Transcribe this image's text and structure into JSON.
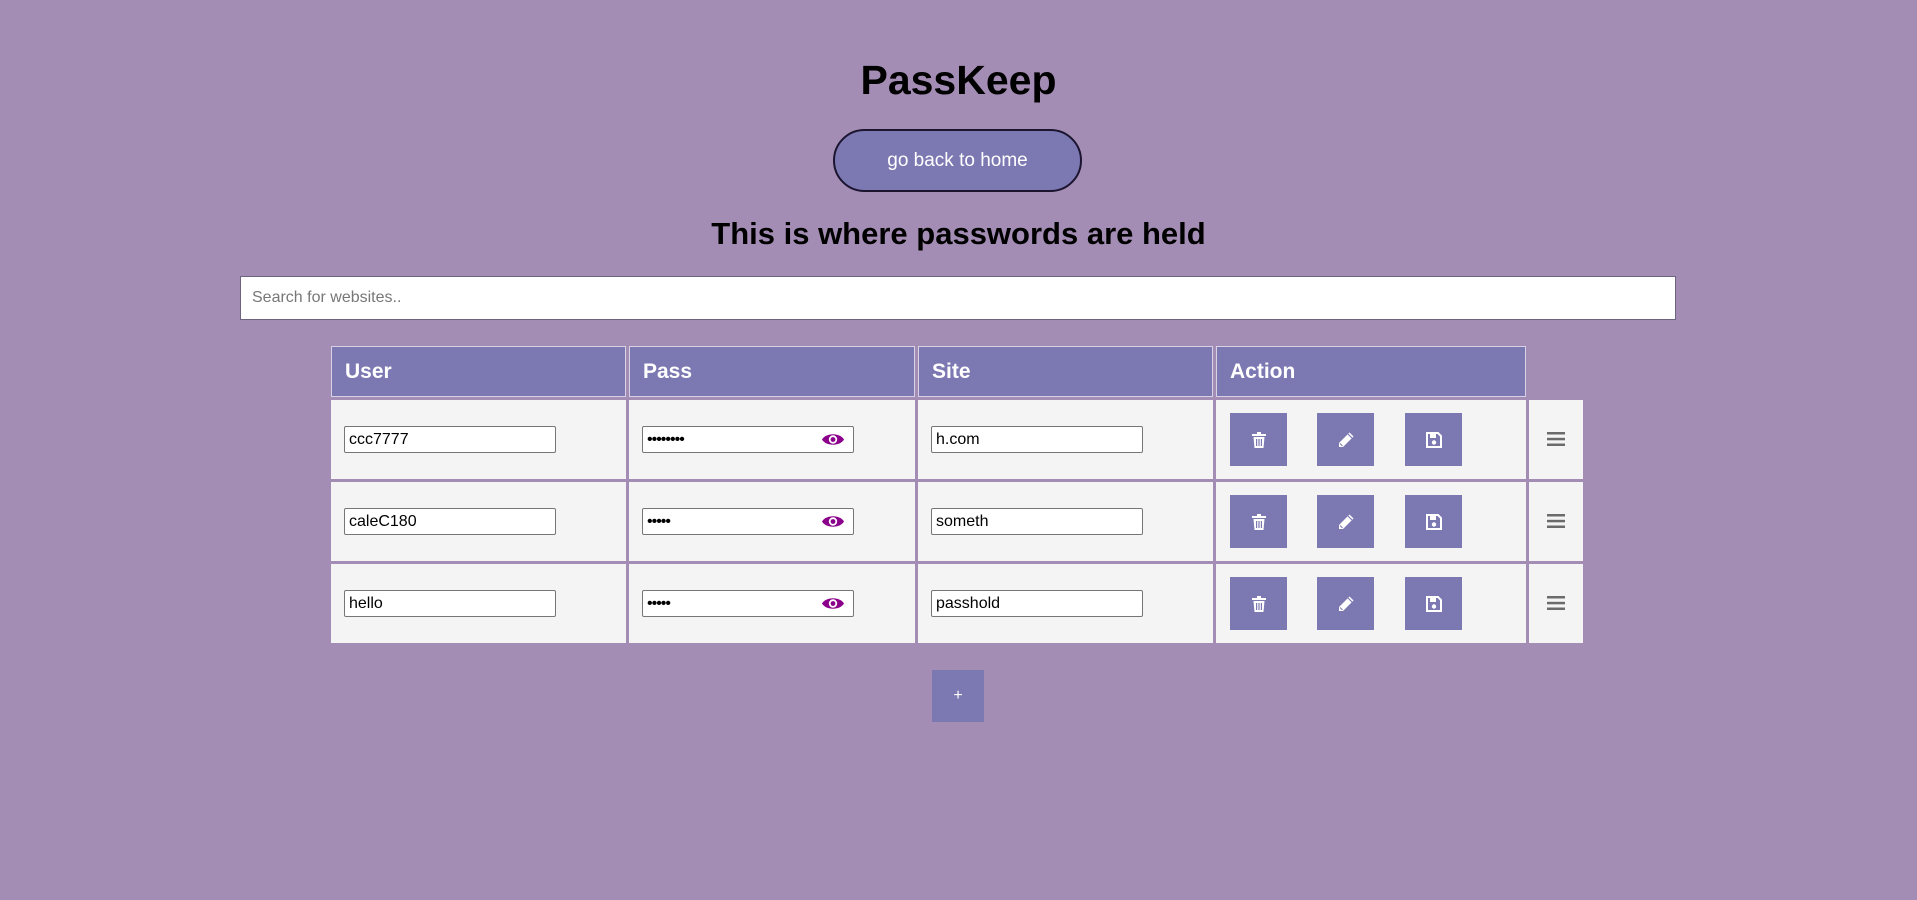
{
  "app": {
    "title": "PassKeep",
    "home_button_label": "go back to home",
    "subtitle": "This is where passwords are held"
  },
  "search": {
    "placeholder": "Search for websites..",
    "value": ""
  },
  "table": {
    "headers": [
      "User",
      "Pass",
      "Site",
      "Action"
    ],
    "rows": [
      {
        "user": "ccc7777",
        "pass": "••••••••",
        "site": "h.com"
      },
      {
        "user": "caleC180",
        "pass": "•••••",
        "site": "someth"
      },
      {
        "user": "hello",
        "pass": "•••••",
        "site": "passhold"
      }
    ],
    "row_actions": [
      "trash-icon",
      "pencil-icon",
      "save-icon"
    ],
    "password_toggle_icon": "eye-icon",
    "drag_handle_icon": "hamburger-icon"
  },
  "add_button_label": "+",
  "colors": {
    "background": "#a48db4",
    "accent": "#7c78b2",
    "eye_icon": "#8b008b",
    "cell_background": "#f4f4f4"
  }
}
